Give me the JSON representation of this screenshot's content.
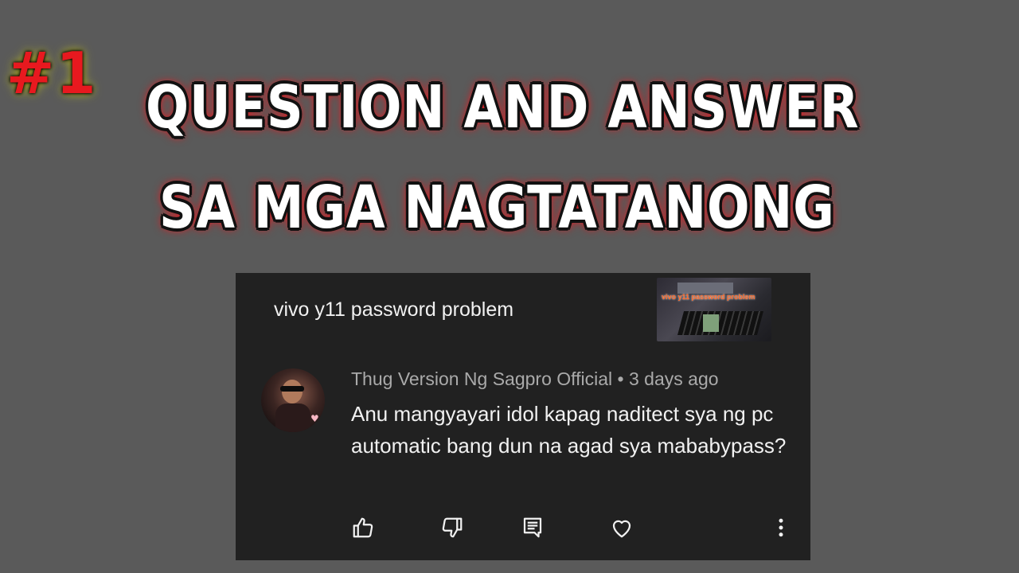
{
  "badge": "#1",
  "headline": {
    "line1": "QUESTION AND ANSWER",
    "line2": "SA MGA NAGTATANONG"
  },
  "colors": {
    "background": "#5a5a5a",
    "card": "#212121",
    "accent_red": "#e8191f",
    "meta_text": "#aaaaaa",
    "body_text": "#f1f1f1"
  },
  "card": {
    "video_title": "vivo y11 password problem",
    "thumbnail_caption": "vivo y11 password problem",
    "comment": {
      "author": "Thug Version Ng Sagpro Official",
      "separator": " • ",
      "time": "3 days ago",
      "text": "Anu mangyayari idol kapag naditect sya ng pc automatic bang dun na agad sya mababypass?"
    },
    "actions": [
      "thumbs-up-icon",
      "thumbs-down-icon",
      "reply-icon",
      "heart-icon",
      "more-vert-icon"
    ]
  }
}
